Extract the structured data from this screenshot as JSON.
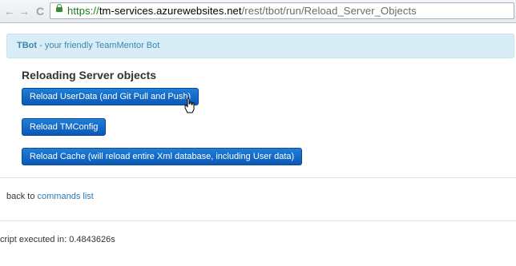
{
  "browser": {
    "back_glyph": "←",
    "forward_glyph": "→",
    "reload_glyph": "C",
    "url_protocol": "https://",
    "url_host": "tm-services.azurewebsites.net",
    "url_path": "/rest/tbot/run/Reload_Server_Objects"
  },
  "banner": {
    "brand": "TBot",
    "tagline": " - your friendly TeamMentor Bot"
  },
  "page": {
    "heading": "Reloading Server objects",
    "buttons": [
      {
        "label": "Reload UserData (and Git Pull and Push)"
      },
      {
        "label": "Reload TMConfig"
      },
      {
        "label": "Reload Cache (will reload entire Xml database, including User data)"
      }
    ],
    "back_prefix": "back to ",
    "back_link": "commands list",
    "script_text": "cript executed in: 0.4843626s"
  },
  "colors": {
    "banner_bg": "#d9edf7",
    "banner_text": "#3a87ad",
    "button_bg": "#0c58b6",
    "link": "#2a7ab8"
  }
}
